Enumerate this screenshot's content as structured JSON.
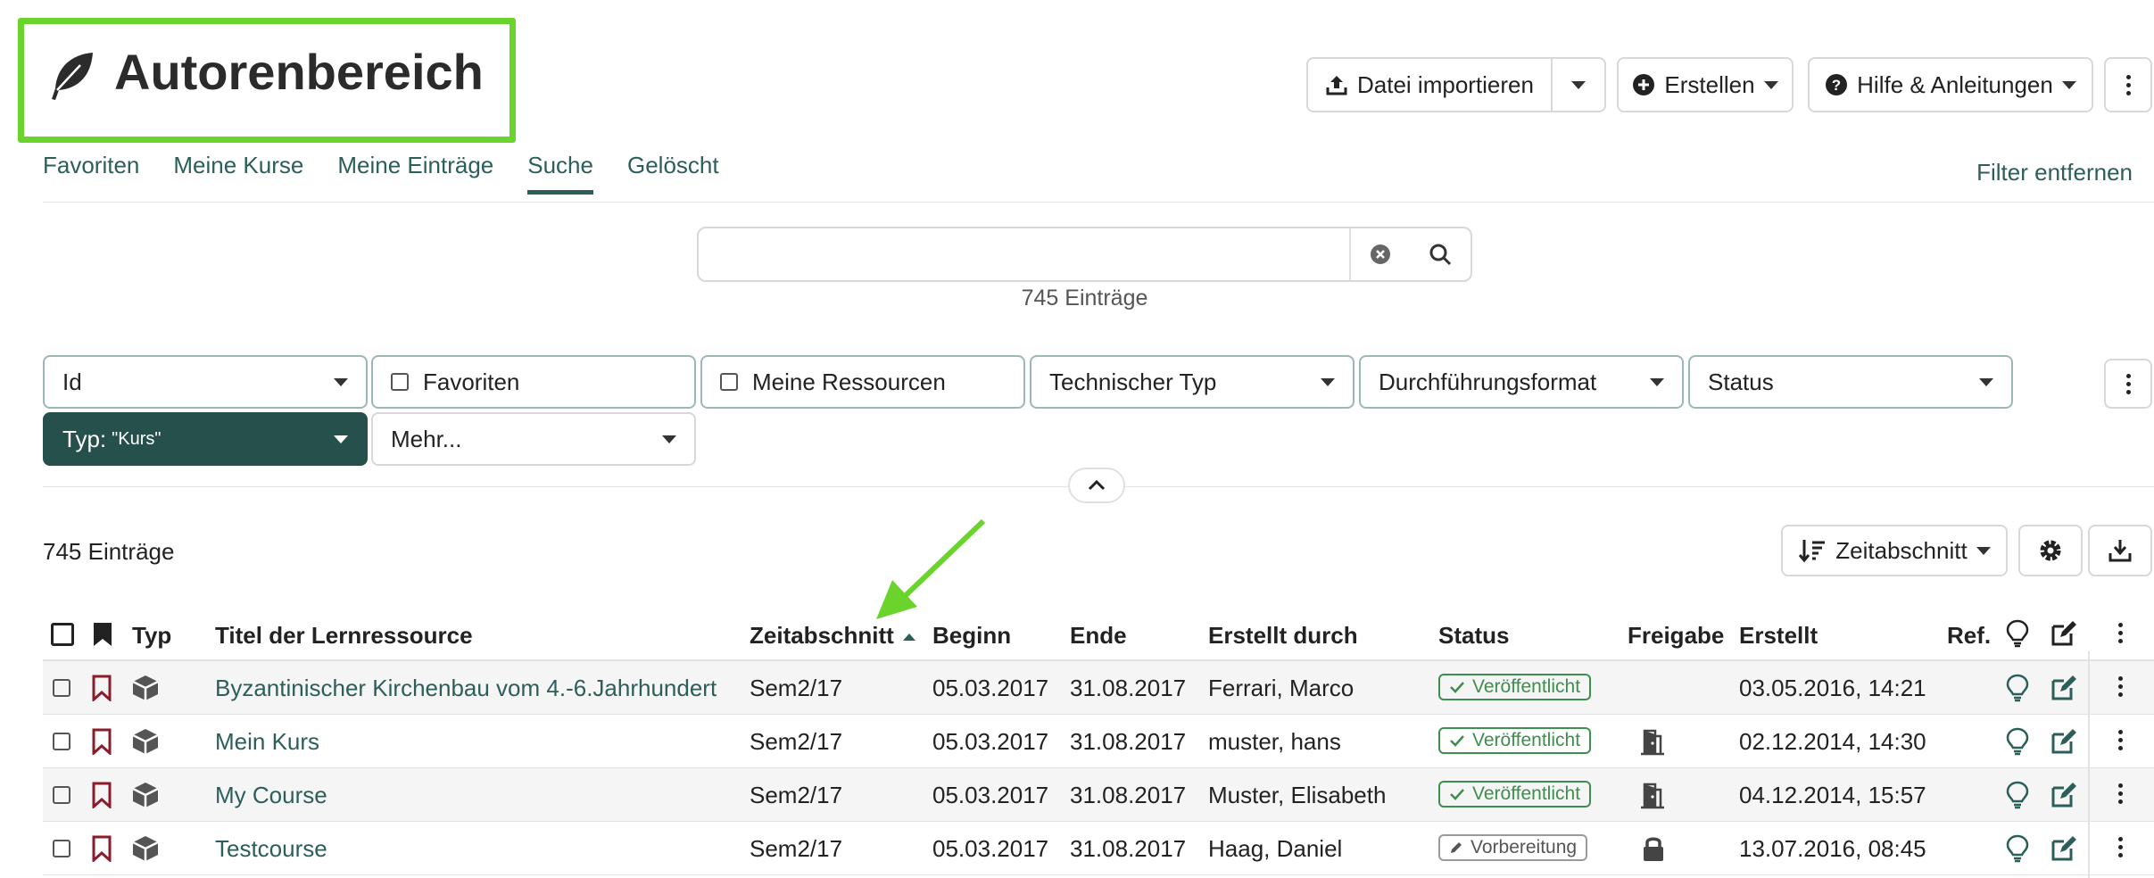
{
  "header": {
    "title": "Autorenbereich",
    "icon": "feather-icon",
    "import_label": "Datei importieren",
    "create_label": "Erstellen",
    "help_label": "Hilfe & Anleitungen"
  },
  "tabs": [
    {
      "label": "Favoriten",
      "active": false
    },
    {
      "label": "Meine Kurse",
      "active": false
    },
    {
      "label": "Meine Einträge",
      "active": false
    },
    {
      "label": "Suche",
      "active": true
    },
    {
      "label": "Gelöscht",
      "active": false
    }
  ],
  "filter_remove": "Filter entfernen",
  "search": {
    "value": "",
    "placeholder": "",
    "result_count": "745 Einträge"
  },
  "filters": {
    "id": "Id",
    "favoriten": "Favoriten",
    "meine_ressourcen": "Meine Ressourcen",
    "technischer_typ": "Technischer Typ",
    "durchfuehrungsformat": "Durchführungsformat",
    "status": "Status",
    "typ_label": "Typ:",
    "typ_value": "\"Kurs\"",
    "mehr": "Mehr..."
  },
  "list": {
    "count": "745 Einträge",
    "sort_label": "Zeitabschnitt"
  },
  "table": {
    "columns": {
      "typ": "Typ",
      "titel": "Titel der Lernressource",
      "zeitabschnitt": "Zeitabschnitt",
      "beginn": "Beginn",
      "ende": "Ende",
      "erstellt_durch": "Erstellt durch",
      "status": "Status",
      "freigabe": "Freigabe",
      "erstellt": "Erstellt",
      "ref": "Ref."
    },
    "rows": [
      {
        "title": "Byzantinischer Kirchenbau vom 4.-6.Jahrhundert",
        "zeitabschnitt": "Sem2/17",
        "beginn": "05.03.2017",
        "ende": "31.08.2017",
        "erstellt_durch": "Ferrari, Marco",
        "status": "Veröffentlicht",
        "freigabe": "",
        "erstellt": "03.05.2016, 14:21"
      },
      {
        "title": "Mein Kurs",
        "zeitabschnitt": "Sem2/17",
        "beginn": "05.03.2017",
        "ende": "31.08.2017",
        "erstellt_durch": "muster, hans",
        "status": "Veröffentlicht",
        "freigabe": "door-icon",
        "erstellt": "02.12.2014, 14:30"
      },
      {
        "title": "My Course",
        "zeitabschnitt": "Sem2/17",
        "beginn": "05.03.2017",
        "ende": "31.08.2017",
        "erstellt_durch": "Muster, Elisabeth",
        "status": "Veröffentlicht",
        "freigabe": "door-icon",
        "erstellt": "04.12.2014, 15:57"
      },
      {
        "title": "Testcourse",
        "zeitabschnitt": "Sem2/17",
        "beginn": "05.03.2017",
        "ende": "31.08.2017",
        "erstellt_durch": "Haag, Daniel",
        "status": "Vorbereitung",
        "freigabe": "lock-icon",
        "erstellt": "13.07.2016, 08:45"
      }
    ]
  },
  "colors": {
    "accent": "#2c5e5a",
    "highlight": "#6ad42c",
    "published": "#3d8f4d",
    "bookmark": "#8b1c2c"
  }
}
